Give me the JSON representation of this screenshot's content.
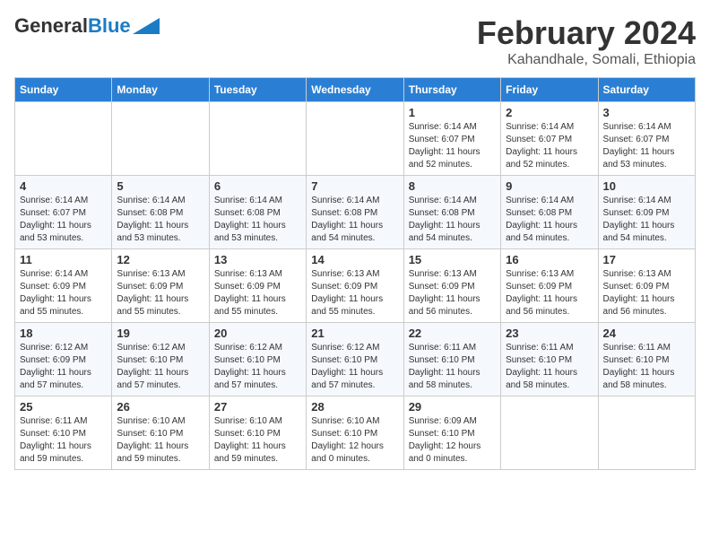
{
  "header": {
    "logo_general": "General",
    "logo_blue": "Blue",
    "month_title": "February 2024",
    "location": "Kahandhale, Somali, Ethiopia"
  },
  "weekdays": [
    "Sunday",
    "Monday",
    "Tuesday",
    "Wednesday",
    "Thursday",
    "Friday",
    "Saturday"
  ],
  "weeks": [
    [
      {
        "day": "",
        "info": ""
      },
      {
        "day": "",
        "info": ""
      },
      {
        "day": "",
        "info": ""
      },
      {
        "day": "",
        "info": ""
      },
      {
        "day": "1",
        "info": "Sunrise: 6:14 AM\nSunset: 6:07 PM\nDaylight: 11 hours\nand 52 minutes."
      },
      {
        "day": "2",
        "info": "Sunrise: 6:14 AM\nSunset: 6:07 PM\nDaylight: 11 hours\nand 52 minutes."
      },
      {
        "day": "3",
        "info": "Sunrise: 6:14 AM\nSunset: 6:07 PM\nDaylight: 11 hours\nand 53 minutes."
      }
    ],
    [
      {
        "day": "4",
        "info": "Sunrise: 6:14 AM\nSunset: 6:07 PM\nDaylight: 11 hours\nand 53 minutes."
      },
      {
        "day": "5",
        "info": "Sunrise: 6:14 AM\nSunset: 6:08 PM\nDaylight: 11 hours\nand 53 minutes."
      },
      {
        "day": "6",
        "info": "Sunrise: 6:14 AM\nSunset: 6:08 PM\nDaylight: 11 hours\nand 53 minutes."
      },
      {
        "day": "7",
        "info": "Sunrise: 6:14 AM\nSunset: 6:08 PM\nDaylight: 11 hours\nand 54 minutes."
      },
      {
        "day": "8",
        "info": "Sunrise: 6:14 AM\nSunset: 6:08 PM\nDaylight: 11 hours\nand 54 minutes."
      },
      {
        "day": "9",
        "info": "Sunrise: 6:14 AM\nSunset: 6:08 PM\nDaylight: 11 hours\nand 54 minutes."
      },
      {
        "day": "10",
        "info": "Sunrise: 6:14 AM\nSunset: 6:09 PM\nDaylight: 11 hours\nand 54 minutes."
      }
    ],
    [
      {
        "day": "11",
        "info": "Sunrise: 6:14 AM\nSunset: 6:09 PM\nDaylight: 11 hours\nand 55 minutes."
      },
      {
        "day": "12",
        "info": "Sunrise: 6:13 AM\nSunset: 6:09 PM\nDaylight: 11 hours\nand 55 minutes."
      },
      {
        "day": "13",
        "info": "Sunrise: 6:13 AM\nSunset: 6:09 PM\nDaylight: 11 hours\nand 55 minutes."
      },
      {
        "day": "14",
        "info": "Sunrise: 6:13 AM\nSunset: 6:09 PM\nDaylight: 11 hours\nand 55 minutes."
      },
      {
        "day": "15",
        "info": "Sunrise: 6:13 AM\nSunset: 6:09 PM\nDaylight: 11 hours\nand 56 minutes."
      },
      {
        "day": "16",
        "info": "Sunrise: 6:13 AM\nSunset: 6:09 PM\nDaylight: 11 hours\nand 56 minutes."
      },
      {
        "day": "17",
        "info": "Sunrise: 6:13 AM\nSunset: 6:09 PM\nDaylight: 11 hours\nand 56 minutes."
      }
    ],
    [
      {
        "day": "18",
        "info": "Sunrise: 6:12 AM\nSunset: 6:09 PM\nDaylight: 11 hours\nand 57 minutes."
      },
      {
        "day": "19",
        "info": "Sunrise: 6:12 AM\nSunset: 6:10 PM\nDaylight: 11 hours\nand 57 minutes."
      },
      {
        "day": "20",
        "info": "Sunrise: 6:12 AM\nSunset: 6:10 PM\nDaylight: 11 hours\nand 57 minutes."
      },
      {
        "day": "21",
        "info": "Sunrise: 6:12 AM\nSunset: 6:10 PM\nDaylight: 11 hours\nand 57 minutes."
      },
      {
        "day": "22",
        "info": "Sunrise: 6:11 AM\nSunset: 6:10 PM\nDaylight: 11 hours\nand 58 minutes."
      },
      {
        "day": "23",
        "info": "Sunrise: 6:11 AM\nSunset: 6:10 PM\nDaylight: 11 hours\nand 58 minutes."
      },
      {
        "day": "24",
        "info": "Sunrise: 6:11 AM\nSunset: 6:10 PM\nDaylight: 11 hours\nand 58 minutes."
      }
    ],
    [
      {
        "day": "25",
        "info": "Sunrise: 6:11 AM\nSunset: 6:10 PM\nDaylight: 11 hours\nand 59 minutes."
      },
      {
        "day": "26",
        "info": "Sunrise: 6:10 AM\nSunset: 6:10 PM\nDaylight: 11 hours\nand 59 minutes."
      },
      {
        "day": "27",
        "info": "Sunrise: 6:10 AM\nSunset: 6:10 PM\nDaylight: 11 hours\nand 59 minutes."
      },
      {
        "day": "28",
        "info": "Sunrise: 6:10 AM\nSunset: 6:10 PM\nDaylight: 12 hours\nand 0 minutes."
      },
      {
        "day": "29",
        "info": "Sunrise: 6:09 AM\nSunset: 6:10 PM\nDaylight: 12 hours\nand 0 minutes."
      },
      {
        "day": "",
        "info": ""
      },
      {
        "day": "",
        "info": ""
      }
    ]
  ]
}
